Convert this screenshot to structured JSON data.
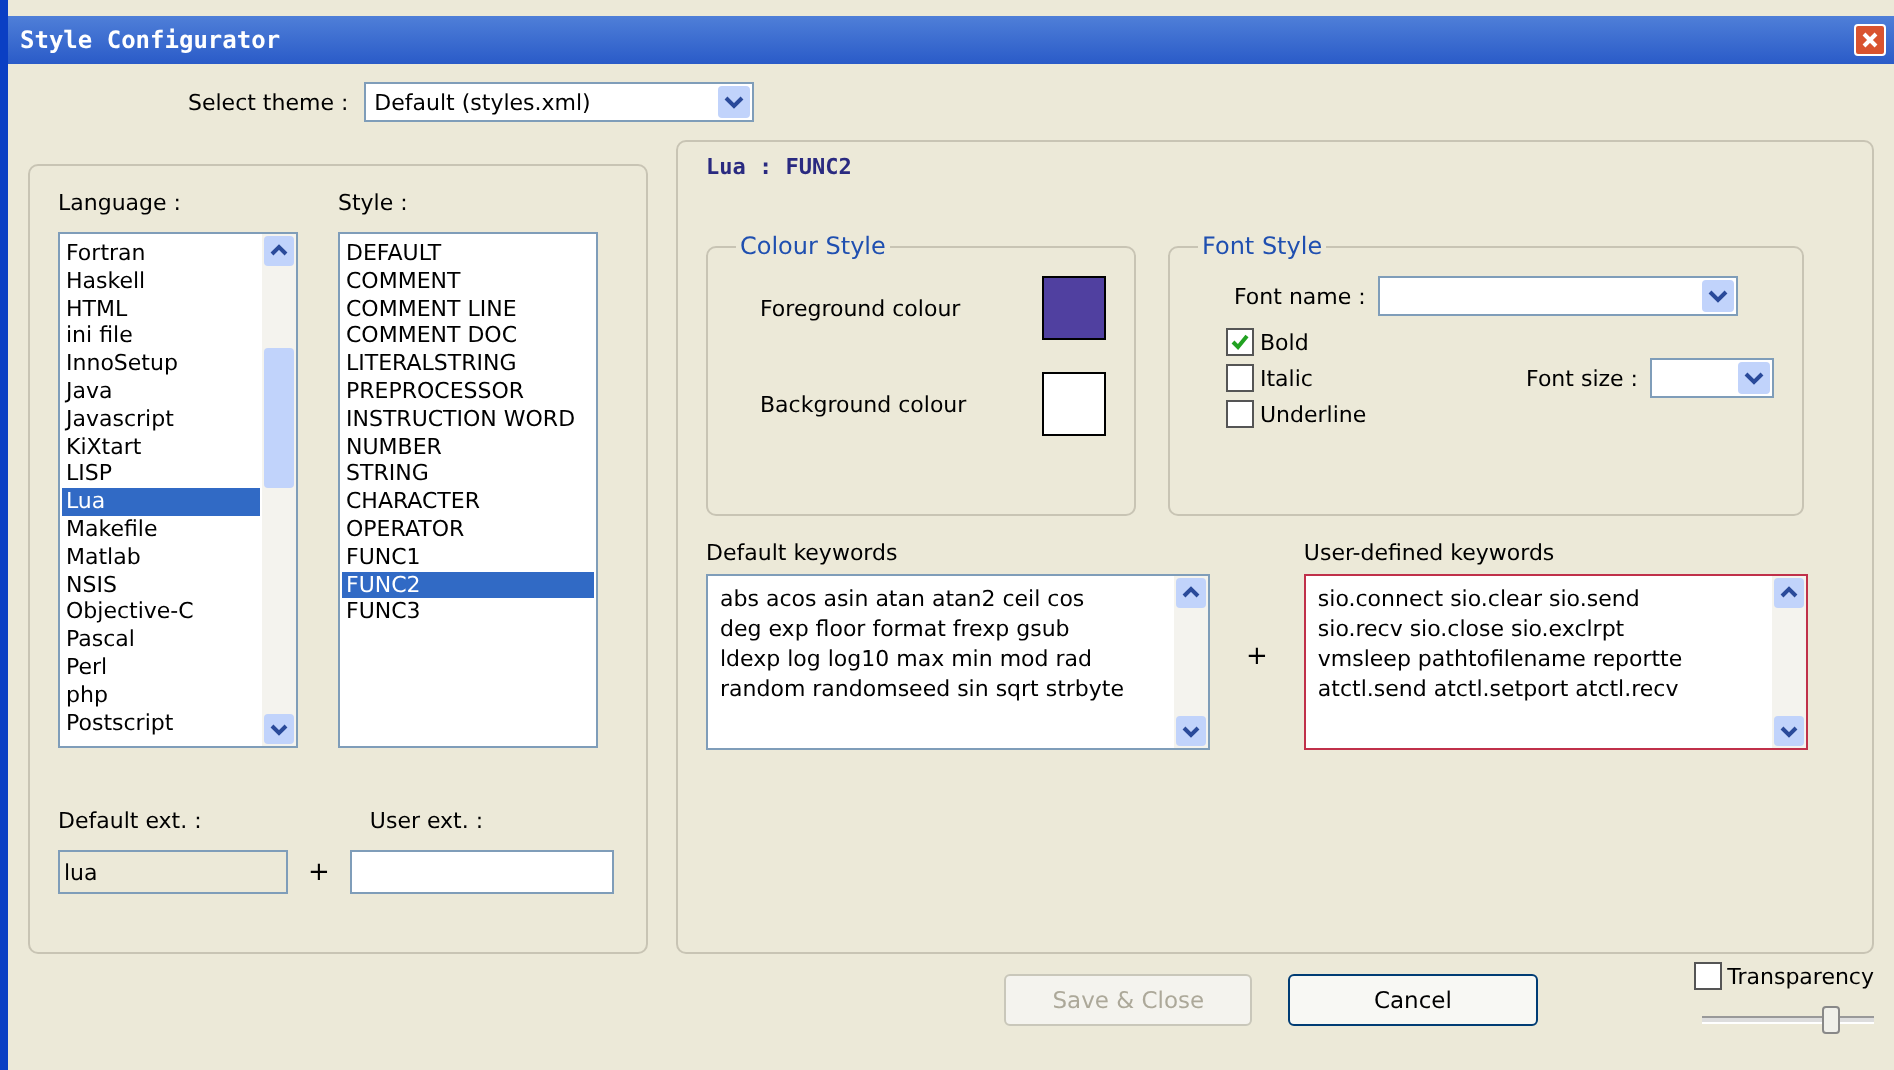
{
  "window": {
    "title": "Style Configurator"
  },
  "theme": {
    "label": "Select theme :",
    "value": "Default (styles.xml)"
  },
  "language": {
    "label": "Language :",
    "items": [
      {
        "label": "Fortran",
        "selected": false
      },
      {
        "label": "Haskell",
        "selected": false
      },
      {
        "label": "HTML",
        "selected": false
      },
      {
        "label": "ini file",
        "selected": false
      },
      {
        "label": "InnoSetup",
        "selected": false
      },
      {
        "label": "Java",
        "selected": false
      },
      {
        "label": "Javascript",
        "selected": false
      },
      {
        "label": "KiXtart",
        "selected": false
      },
      {
        "label": "LISP",
        "selected": false
      },
      {
        "label": "Lua",
        "selected": true
      },
      {
        "label": "Makefile",
        "selected": false
      },
      {
        "label": "Matlab",
        "selected": false
      },
      {
        "label": "NSIS",
        "selected": false
      },
      {
        "label": "Objective-C",
        "selected": false
      },
      {
        "label": "Pascal",
        "selected": false
      },
      {
        "label": "Perl",
        "selected": false
      },
      {
        "label": "php",
        "selected": false
      },
      {
        "label": "Postscript",
        "selected": false
      }
    ]
  },
  "style": {
    "label": "Style :",
    "items": [
      {
        "label": "DEFAULT",
        "selected": false
      },
      {
        "label": "COMMENT",
        "selected": false
      },
      {
        "label": "COMMENT LINE",
        "selected": false
      },
      {
        "label": "COMMENT DOC",
        "selected": false
      },
      {
        "label": "LITERALSTRING",
        "selected": false
      },
      {
        "label": "PREPROCESSOR",
        "selected": false
      },
      {
        "label": "INSTRUCTION WORD",
        "selected": false
      },
      {
        "label": "NUMBER",
        "selected": false
      },
      {
        "label": "STRING",
        "selected": false
      },
      {
        "label": "CHARACTER",
        "selected": false
      },
      {
        "label": "OPERATOR",
        "selected": false
      },
      {
        "label": "FUNC1",
        "selected": false
      },
      {
        "label": "FUNC2",
        "selected": true
      },
      {
        "label": "FUNC3",
        "selected": false
      }
    ]
  },
  "default_ext": {
    "label": "Default ext. :",
    "value": "lua"
  },
  "ext_plus": "+",
  "user_ext": {
    "label": "User ext. :"
  },
  "heading": "Lua : FUNC2",
  "colour_style": {
    "title": "Colour Style",
    "foreground": {
      "label": "Foreground colour",
      "color": "#5040a0"
    },
    "background": {
      "label": "Background colour",
      "color": "#ffffff"
    }
  },
  "font_style": {
    "title": "Font Style",
    "font_name_label": "Font name :",
    "font_size_label": "Font size :",
    "options": [
      {
        "label": "Bold",
        "checked": true
      },
      {
        "label": "Italic",
        "checked": false
      },
      {
        "label": "Underline",
        "checked": false
      }
    ]
  },
  "default_keywords": {
    "label": "Default keywords",
    "text": "abs acos asin atan atan2 ceil cos\ndeg exp floor format frexp gsub\nldexp log log10 max min mod rad\nrandom randomseed sin sqrt strbyte"
  },
  "keywords_plus": "+",
  "user_keywords": {
    "label": "User-defined keywords",
    "text": "sio.connect sio.clear sio.send\nsio.recv sio.close sio.exclrpt\nvmsleep pathtofilename reportte\natctl.send atctl.setport atctl.recv"
  },
  "buttons": [
    {
      "label": "Save & Close",
      "disabled": true
    },
    {
      "label": "Cancel",
      "disabled": false
    }
  ],
  "transparency": {
    "label": "Transparency",
    "checked": false,
    "level": 0.78
  }
}
